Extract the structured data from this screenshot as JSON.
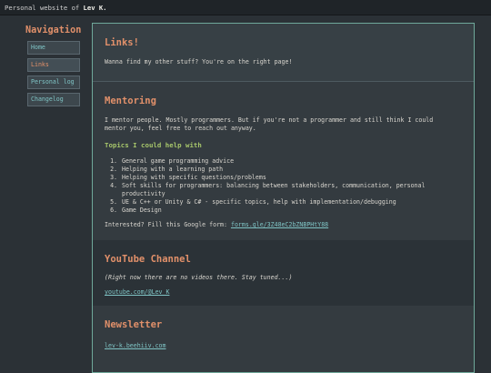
{
  "header": {
    "prefix": "Personal website of",
    "owner": "Lev K."
  },
  "nav": {
    "title": "Navigation",
    "items": [
      {
        "label": "Home"
      },
      {
        "label": "Links"
      },
      {
        "label": "Personal log"
      },
      {
        "label": "Changelog"
      }
    ]
  },
  "links_section": {
    "title": "Links!",
    "text": "Wanna find my other stuff? You're on the right page!"
  },
  "mentoring": {
    "title": "Mentoring",
    "intro": "I mentor people. Mostly programmers. But if you're not a programmer and still think I could mentor you, feel free to reach out anyway.",
    "topics_title": "Topics I could help with",
    "topics": [
      "General game programming advice",
      "Helping with a learning path",
      "Helping with specific questions/problems",
      "Soft skills for programmers: balancing between stakeholders, communication, personal productivity",
      "UE & C++ or Unity & C# - specific topics, help with implementation/debugging",
      "Game Design"
    ],
    "form_prefix": "Interested? Fill this Google form:",
    "form_link": "forms.gle/3Z48eC2bZNBPHtY88"
  },
  "youtube": {
    "title": "YouTube Channel",
    "note": "(Right now there are no videos there. Stay tuned...)",
    "link": "youtube.com/@Lev_K"
  },
  "newsletter": {
    "title": "Newsletter",
    "link": "lev-k.beehiiv.com"
  }
}
